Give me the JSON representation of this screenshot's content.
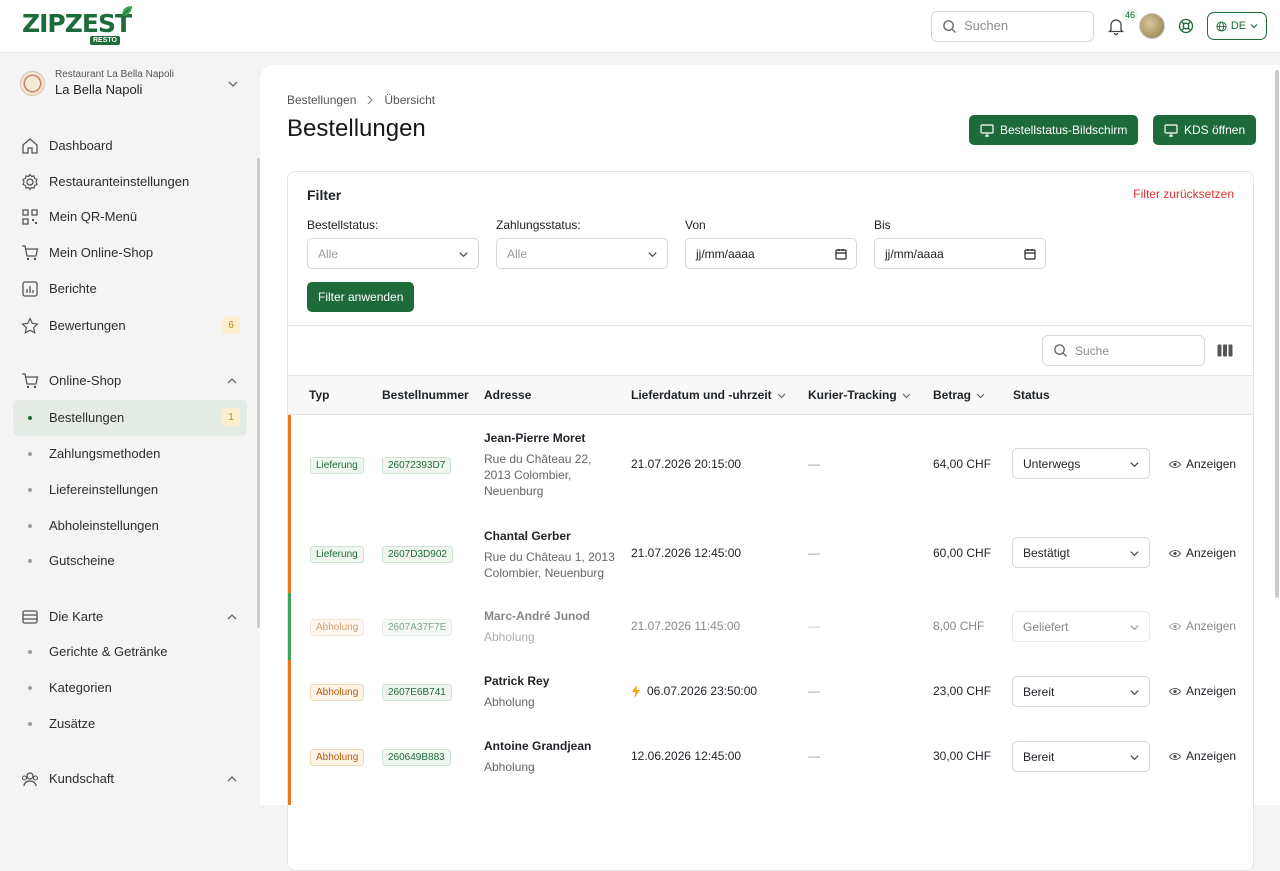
{
  "brand": {
    "name": "ZIPZEST",
    "badge": "RESTO",
    "color": "#1e6b3a"
  },
  "topbar": {
    "search_placeholder": "Suchen",
    "notifications_count": "46",
    "language": "DE"
  },
  "restaurant": {
    "subtitle": "Restaurant La Bella Napoli",
    "name": "La Bella Napoli"
  },
  "sidebar": {
    "items": [
      {
        "label": "Dashboard",
        "icon": "home-icon"
      },
      {
        "label": "Restauranteinstellungen",
        "icon": "gear-icon"
      },
      {
        "label": "Mein QR-Menü",
        "icon": "qr-icon"
      },
      {
        "label": "Mein Online-Shop",
        "icon": "cart-icon"
      },
      {
        "label": "Berichte",
        "icon": "chart-icon"
      },
      {
        "label": "Bewertungen",
        "icon": "star-icon",
        "badge": "6"
      }
    ],
    "online_shop": {
      "label": "Online-Shop",
      "children": [
        {
          "label": "Bestellungen",
          "badge": "1",
          "active": true
        },
        {
          "label": "Zahlungsmethoden"
        },
        {
          "label": "Liefereinstellungen"
        },
        {
          "label": "Abholeinstellungen"
        },
        {
          "label": "Gutscheine"
        }
      ]
    },
    "karte": {
      "label": "Die Karte",
      "children": [
        {
          "label": "Gerichte & Getränke"
        },
        {
          "label": "Kategorien"
        },
        {
          "label": "Zusätze"
        }
      ]
    },
    "kundschaft": {
      "label": "Kundschaft"
    }
  },
  "breadcrumb": {
    "parent": "Bestellungen",
    "current": "Übersicht"
  },
  "page": {
    "title": "Bestellungen",
    "btn_status_screen": "Bestellstatus-Bildschirm",
    "btn_kds": "KDS öffnen"
  },
  "filter": {
    "title": "Filter",
    "reset": "Filter zurücksetzen",
    "order_status_label": "Bestellstatus:",
    "order_status_value": "Alle",
    "payment_status_label": "Zahlungsstatus:",
    "payment_status_value": "Alle",
    "from_label": "Von",
    "from_value": "jj/mm/aaaa",
    "to_label": "Bis",
    "to_value": "jj/mm/aaaa",
    "apply": "Filter anwenden"
  },
  "table": {
    "search_placeholder": "Suche",
    "columns": [
      "Typ",
      "Bestellnummer",
      "Adresse",
      "Lieferdatum und -uhrzeit",
      "Kurier-Tracking",
      "Betrag",
      "Status"
    ],
    "view_label": "Anzeigen",
    "rows": [
      {
        "type": "Lieferung",
        "number": "26072393D7",
        "name": "Jean-Pierre Moret",
        "address": [
          "Rue du Château 22,",
          "2013 Colombier,",
          "Neuenburg"
        ],
        "datetime": "21.07.2026 20:15:00",
        "tracking": "—",
        "amount": "64,00 CHF",
        "status": "Unterwegs",
        "bar": "#e8761c"
      },
      {
        "type": "Lieferung",
        "number": "2607D3D902",
        "name": "Chantal Gerber",
        "address": [
          "Rue du Château 1, 2013",
          "Colombier, Neuenburg"
        ],
        "datetime": "21.07.2026 12:45:00",
        "tracking": "—",
        "amount": "60,00 CHF",
        "status": "Bestätigt",
        "bar": "#e8761c"
      },
      {
        "type": "Abholung",
        "number": "2607A37F7E",
        "name": "Marc-André Junod",
        "address": [
          "Abholung"
        ],
        "datetime": "21.07.2026 11:45:00",
        "tracking": "—",
        "amount": "8,00 CHF",
        "status": "Geliefert",
        "bar": "#3aa655"
      },
      {
        "type": "Abholung",
        "number": "2607E6B741",
        "name": "Patrick Rey",
        "address": [
          "Abholung"
        ],
        "datetime": "06.07.2026 23:50:00",
        "tracking": "—",
        "amount": "23,00 CHF",
        "status": "Bereit",
        "bar": "#e8761c"
      },
      {
        "type": "Abholung",
        "number": "260649B883",
        "name": "Antoine Grandjean",
        "address": [
          "Abholung"
        ],
        "datetime": "12.06.2026 12:45:00",
        "tracking": "—",
        "amount": "30,00 CHF",
        "status": "Bereit",
        "bar": "#e8761c"
      }
    ]
  }
}
